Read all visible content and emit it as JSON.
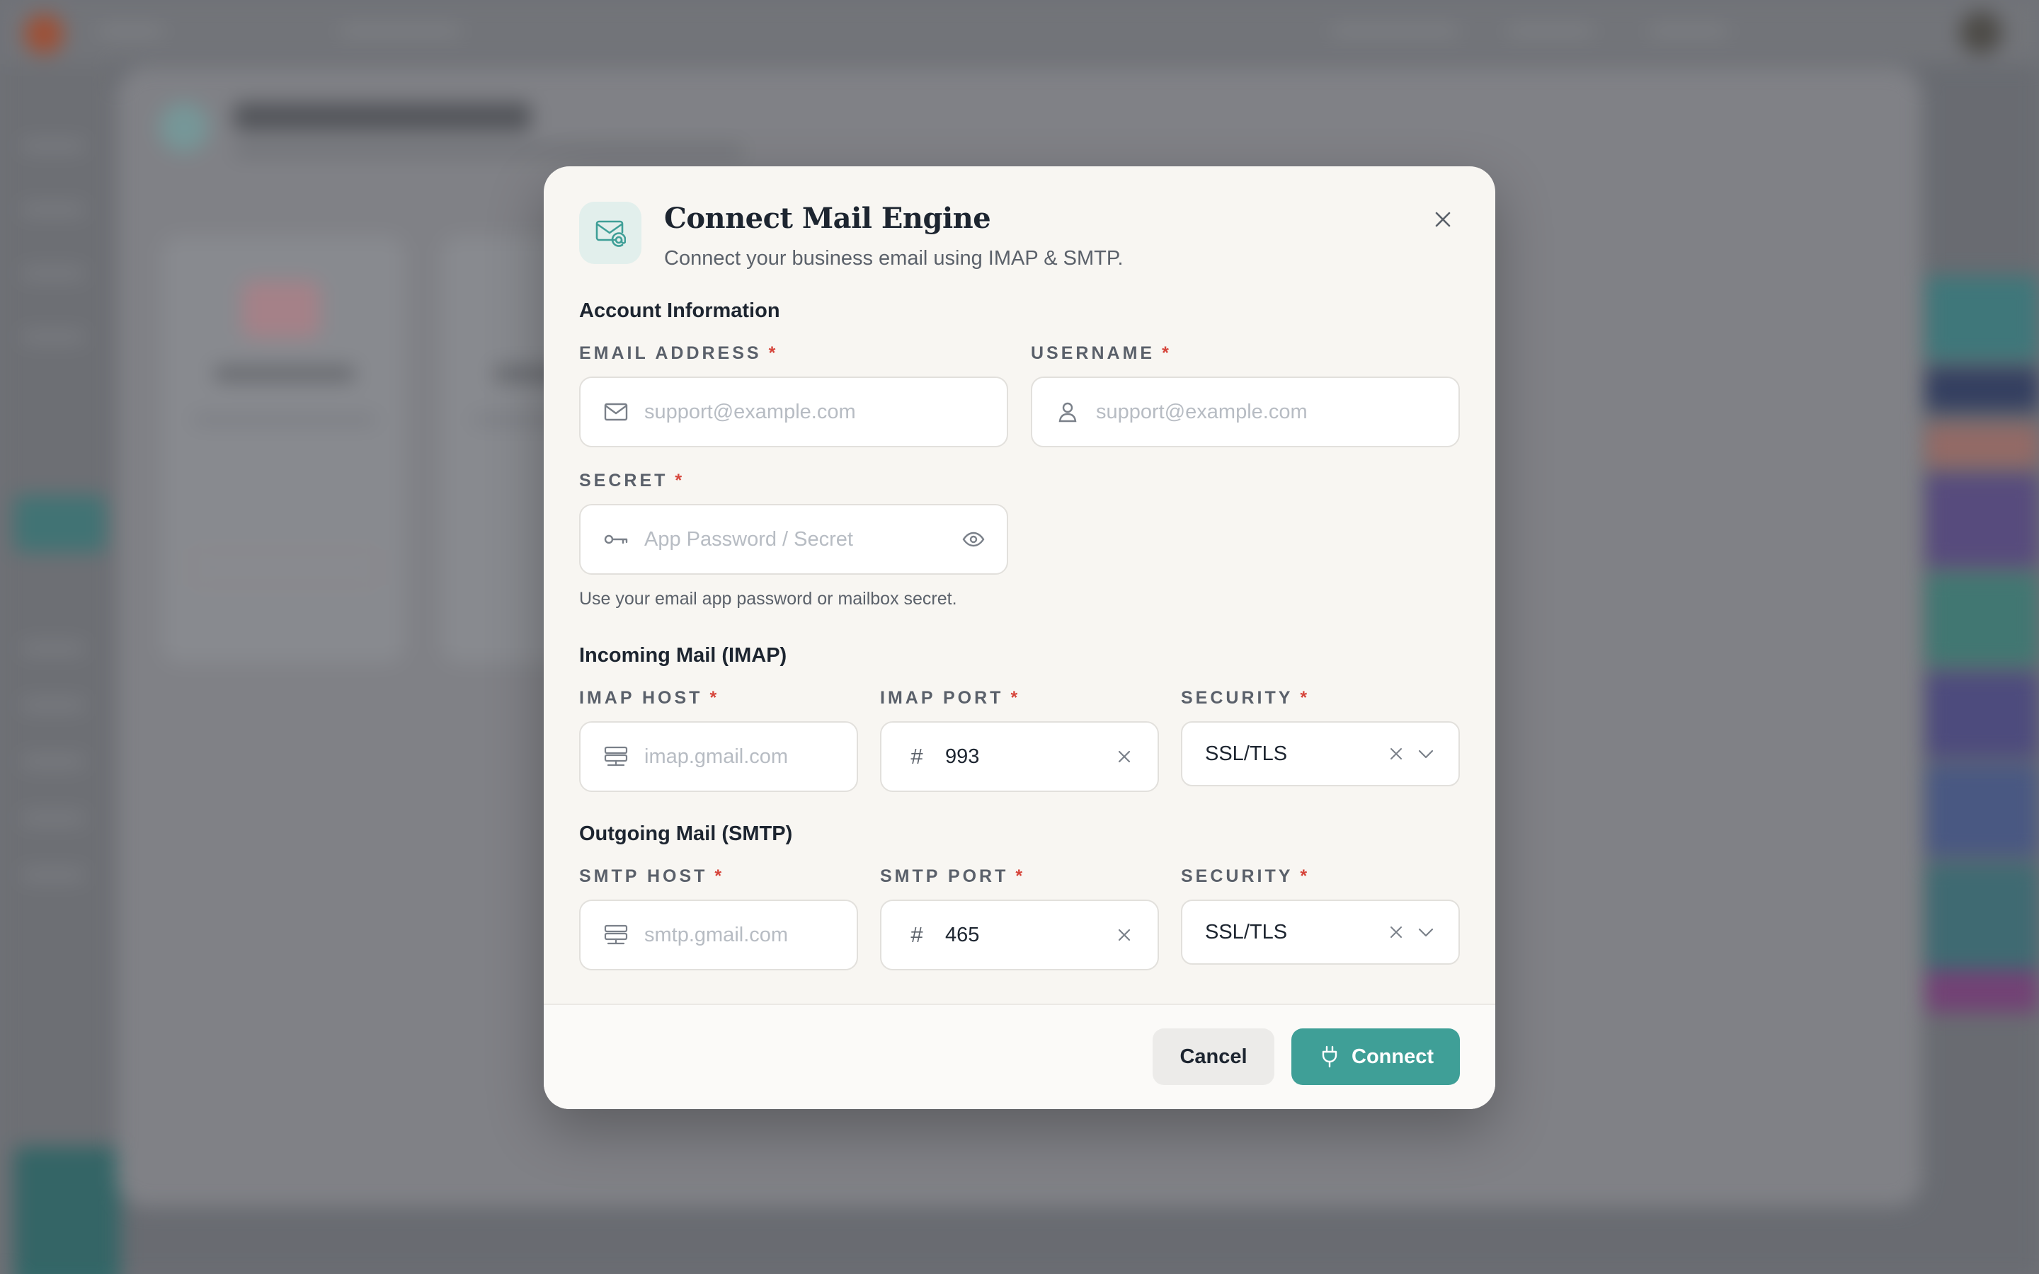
{
  "modal": {
    "title": "Connect Mail Engine",
    "subtitle": "Connect your business email using IMAP & SMTP.",
    "icon": "mail-at-icon",
    "accent_color": "#3f9f97"
  },
  "account": {
    "section_title": "Account Information",
    "email": {
      "label": "EMAIL ADDRESS",
      "required": "*",
      "placeholder": "support@example.com",
      "icon": "mail-icon"
    },
    "username": {
      "label": "USERNAME",
      "required": "*",
      "placeholder": "support@example.com",
      "icon": "user-icon"
    },
    "secret": {
      "label": "SECRET",
      "required": "*",
      "placeholder": "App Password / Secret",
      "icon": "key-icon",
      "toggle_icon": "eye-icon"
    },
    "helper": "Use your email app password or mailbox secret."
  },
  "imap": {
    "section_title": "Incoming Mail (IMAP)",
    "host": {
      "label": "IMAP HOST",
      "required": "*",
      "placeholder": "imap.gmail.com",
      "icon": "server-icon"
    },
    "port": {
      "label": "IMAP PORT",
      "required": "*",
      "prefix": "#",
      "value": "993"
    },
    "security": {
      "label": "SECURITY",
      "required": "*",
      "value": "SSL/TLS"
    }
  },
  "smtp": {
    "section_title": "Outgoing Mail (SMTP)",
    "host": {
      "label": "SMTP HOST",
      "required": "*",
      "placeholder": "smtp.gmail.com",
      "icon": "server-icon"
    },
    "port": {
      "label": "SMTP PORT",
      "required": "*",
      "prefix": "#",
      "value": "465"
    },
    "security": {
      "label": "SECURITY",
      "required": "*",
      "value": "SSL/TLS"
    }
  },
  "footer": {
    "cancel_label": "Cancel",
    "connect_label": "Connect",
    "connect_icon": "plug-icon"
  }
}
